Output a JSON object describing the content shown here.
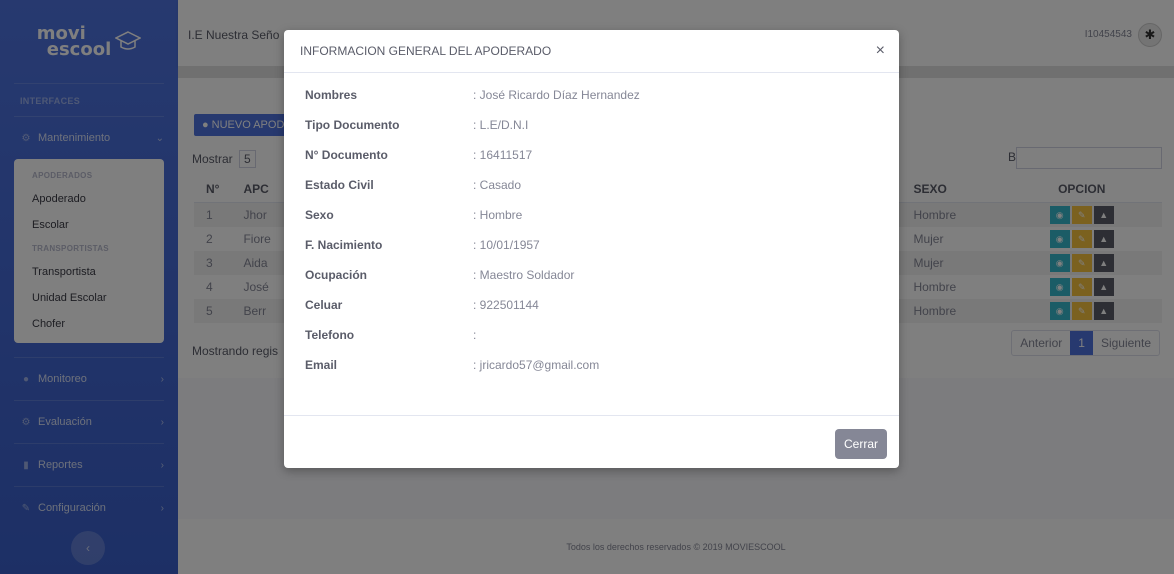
{
  "brand": {
    "line1": "movi",
    "line2": "escool"
  },
  "sidebar": {
    "heading": "INTERFACES",
    "mantenimiento": "Mantenimiento",
    "submenu": {
      "h1": "APODERADOS",
      "i1": "Apoderado",
      "i2": "Escolar",
      "h2": "TRANSPORTISTAS",
      "i3": "Transportista",
      "i4": "Unidad Escolar",
      "i5": "Chofer"
    },
    "monitoreo": "Monitoreo",
    "evaluacion": "Evaluación",
    "reportes": "Reportes",
    "configuracion": "Configuración"
  },
  "topbar": {
    "institution": "I.E Nuestra Seño",
    "user": "I10454543"
  },
  "content": {
    "new_button": "NUEVO APOD",
    "show_label": "Mostrar",
    "show_value": "5",
    "search_label": "Buscar:",
    "table": {
      "headers": [
        "N°",
        "APC",
        "SEXO",
        "OPCION"
      ],
      "rows": [
        {
          "n": "1",
          "name": "Jhor",
          "sexo": "Hombre"
        },
        {
          "n": "2",
          "name": "Fiore",
          "sexo": "Mujer"
        },
        {
          "n": "3",
          "name": "Aida",
          "sexo": "Mujer"
        },
        {
          "n": "4",
          "name": "José",
          "sexo": "Hombre"
        },
        {
          "n": "5",
          "name": "Berr",
          "sexo": "Hombre"
        }
      ]
    },
    "info": "Mostrando regis",
    "pager": {
      "prev": "Anterior",
      "current": "1",
      "next": "Siguiente"
    }
  },
  "footer": "Todos los derechos reservados © 2019 MOVIESCOOL",
  "modal": {
    "title": "INFORMACION GENERAL DEL APODERADO",
    "close_x": "×",
    "fields": [
      {
        "k": "Nombres",
        "v": ": José Ricardo Díaz Hernandez"
      },
      {
        "k": "Tipo Documento",
        "v": ": L.E/D.N.I"
      },
      {
        "k": "N° Documento",
        "v": ": 16411517"
      },
      {
        "k": "Estado Civil",
        "v": ": Casado"
      },
      {
        "k": "Sexo",
        "v": ": Hombre"
      },
      {
        "k": "F. Nacimiento",
        "v": ": 10/01/1957"
      },
      {
        "k": "Ocupación",
        "v": ": Maestro Soldador"
      },
      {
        "k": "Celuar",
        "v": ": 922501144"
      },
      {
        "k": "Telefono",
        "v": ":"
      },
      {
        "k": "Email",
        "v": ": jricardo57@gmail.com"
      }
    ],
    "close_button": "Cerrar"
  }
}
